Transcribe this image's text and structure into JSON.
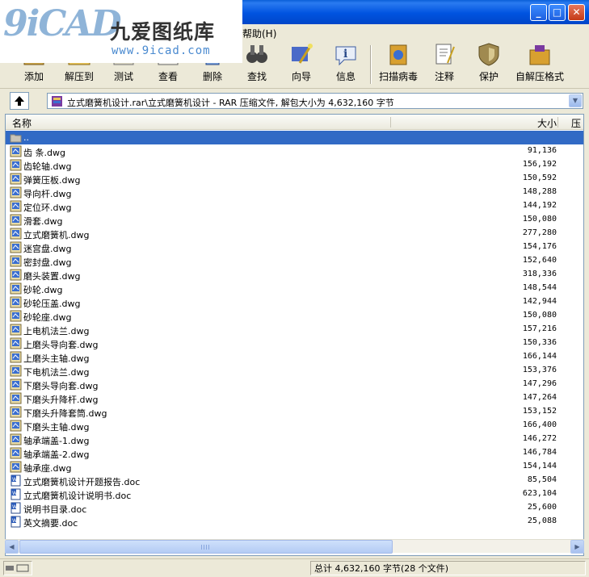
{
  "logo": {
    "mark": "9iCAD",
    "cn_text": "九爱图纸库",
    "url": "www.9icad.com"
  },
  "menu": {
    "help": "帮助(H)"
  },
  "toolbar": {
    "add": "添加",
    "extract": "解压到",
    "test": "测试",
    "view": "查看",
    "delete": "删除",
    "find": "查找",
    "wizard": "向导",
    "info": "信息",
    "scan": "扫描病毒",
    "comment": "注释",
    "protect": "保护",
    "sfx": "自解压格式"
  },
  "address": {
    "path": "立式磨簧机设计.rar\\立式磨簧机设计 - RAR 压缩文件, 解包大小为 4,632,160 字节"
  },
  "columns": {
    "name": "名称",
    "size": "大小",
    "packed": "压缩"
  },
  "files": [
    {
      "name": "..",
      "size": "",
      "icon": "folder-icon",
      "selected": true
    },
    {
      "name": "齿 条.dwg",
      "size": "91,136",
      "icon": "dwg-file-icon"
    },
    {
      "name": "齿轮轴.dwg",
      "size": "156,192",
      "icon": "dwg-file-icon"
    },
    {
      "name": "弹簧压板.dwg",
      "size": "150,592",
      "icon": "dwg-file-icon"
    },
    {
      "name": "导向杆.dwg",
      "size": "148,288",
      "icon": "dwg-file-icon"
    },
    {
      "name": "定位环.dwg",
      "size": "144,192",
      "icon": "dwg-file-icon"
    },
    {
      "name": "滑套.dwg",
      "size": "150,080",
      "icon": "dwg-file-icon"
    },
    {
      "name": "立式磨簧机.dwg",
      "size": "277,280",
      "icon": "dwg-file-icon"
    },
    {
      "name": "迷宫盘.dwg",
      "size": "154,176",
      "icon": "dwg-file-icon"
    },
    {
      "name": "密封盘.dwg",
      "size": "152,640",
      "icon": "dwg-file-icon"
    },
    {
      "name": "磨头装置.dwg",
      "size": "318,336",
      "icon": "dwg-file-icon"
    },
    {
      "name": "砂轮.dwg",
      "size": "148,544",
      "icon": "dwg-file-icon"
    },
    {
      "name": "砂轮压盖.dwg",
      "size": "142,944",
      "icon": "dwg-file-icon"
    },
    {
      "name": "砂轮座.dwg",
      "size": "150,080",
      "icon": "dwg-file-icon"
    },
    {
      "name": "上电机法兰.dwg",
      "size": "157,216",
      "icon": "dwg-file-icon"
    },
    {
      "name": "上磨头导向套.dwg",
      "size": "150,336",
      "icon": "dwg-file-icon"
    },
    {
      "name": "上磨头主轴.dwg",
      "size": "166,144",
      "icon": "dwg-file-icon"
    },
    {
      "name": "下电机法兰.dwg",
      "size": "153,376",
      "icon": "dwg-file-icon"
    },
    {
      "name": "下磨头导向套.dwg",
      "size": "147,296",
      "icon": "dwg-file-icon"
    },
    {
      "name": "下磨头升降杆.dwg",
      "size": "147,264",
      "icon": "dwg-file-icon"
    },
    {
      "name": "下磨头升降套筒.dwg",
      "size": "153,152",
      "icon": "dwg-file-icon"
    },
    {
      "name": "下磨头主轴.dwg",
      "size": "166,400",
      "icon": "dwg-file-icon"
    },
    {
      "name": "轴承端盖-1.dwg",
      "size": "146,272",
      "icon": "dwg-file-icon"
    },
    {
      "name": "轴承端盖-2.dwg",
      "size": "146,784",
      "icon": "dwg-file-icon"
    },
    {
      "name": "轴承座.dwg",
      "size": "154,144",
      "icon": "dwg-file-icon"
    },
    {
      "name": "立式磨簧机设计开题报告.doc",
      "size": "85,504",
      "icon": "doc-file-icon"
    },
    {
      "name": "立式磨簧机设计说明书.doc",
      "size": "623,104",
      "icon": "doc-file-icon"
    },
    {
      "name": "说明书目录.doc",
      "size": "25,600",
      "icon": "doc-file-icon"
    },
    {
      "name": "英文摘要.doc",
      "size": "25,088",
      "icon": "doc-file-icon"
    }
  ],
  "status": {
    "total": "总计 4,632,160 字节(28 个文件)"
  }
}
